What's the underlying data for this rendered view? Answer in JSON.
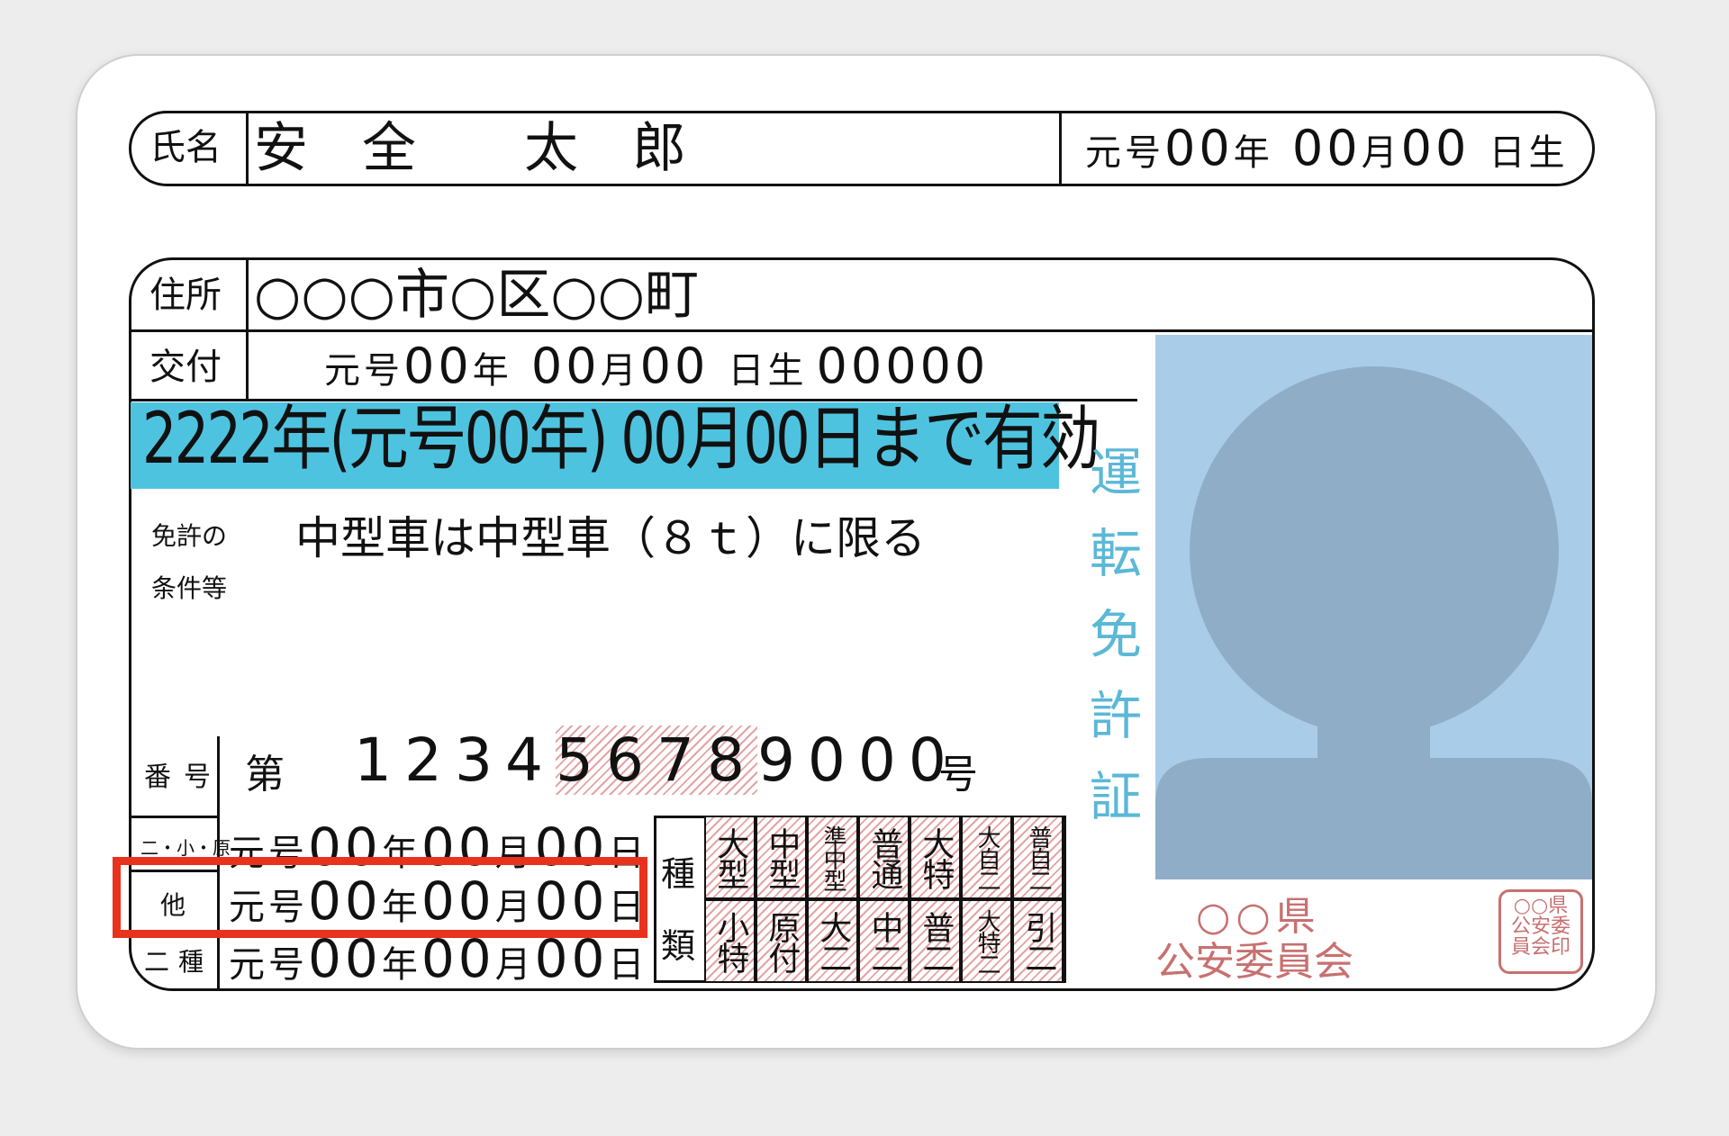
{
  "name": {
    "label": "氏名",
    "value": "安　全　　太　郎"
  },
  "birth": {
    "era": "元号",
    "year": "00",
    "year_unit": "年",
    "month": "00",
    "month_unit": "月",
    "day": "00",
    "day_unit": "日生"
  },
  "address": {
    "label": "住所",
    "value": "○○○市○区○○町"
  },
  "issue": {
    "label": "交付",
    "era": "元号",
    "year": "00",
    "year_unit": "年",
    "month": "00",
    "month_unit": "月",
    "day": "00",
    "day_unit": "日生",
    "number": "00000"
  },
  "expiry": {
    "text": "2222年(元号00年) 00月00日まで有効",
    "band_color": "#4ec3e0"
  },
  "conditions": {
    "label_line1": "免許の",
    "label_line2": "条件等",
    "value": "中型車は中型車（８ｔ）に限る"
  },
  "license_number": {
    "label": "番号",
    "prefix": "第",
    "digits_plain": "1234",
    "digits_hatched": "5678",
    "digits_tail": "9000",
    "suffix": "号"
  },
  "date_rows": [
    {
      "label": "二・小・原",
      "era": "元号",
      "year": "00",
      "month": "00",
      "day": "00",
      "year_unit": "年",
      "month_unit": "月",
      "day_unit": "日"
    },
    {
      "label": "他",
      "era": "元号",
      "year": "00",
      "month": "00",
      "day": "00",
      "year_unit": "年",
      "month_unit": "月",
      "day_unit": "日"
    },
    {
      "label": "二種",
      "era": "元号",
      "year": "00",
      "month": "00",
      "day": "00",
      "year_unit": "年",
      "month_unit": "月",
      "day_unit": "日"
    }
  ],
  "types": {
    "label_top": "種",
    "label_bottom": "類",
    "top_row": [
      "大型",
      "中型",
      "準中型",
      "普通",
      "大特",
      "大自二",
      "普自二"
    ],
    "bottom_row": [
      "小特",
      "原付",
      "大二",
      "中二",
      "普二",
      "大特二",
      "引二"
    ]
  },
  "title": {
    "text": "運転免許証",
    "color": "#5bb8d6"
  },
  "photo": {
    "bg_color": "#a9cde9",
    "silhouette_color": "#8fadc7"
  },
  "issuer": {
    "line1": "○○県",
    "line2": "公安委員会",
    "seal": "○○県公安委員会印",
    "color": "#c87070"
  },
  "highlight": {
    "color": "#e8321e"
  }
}
